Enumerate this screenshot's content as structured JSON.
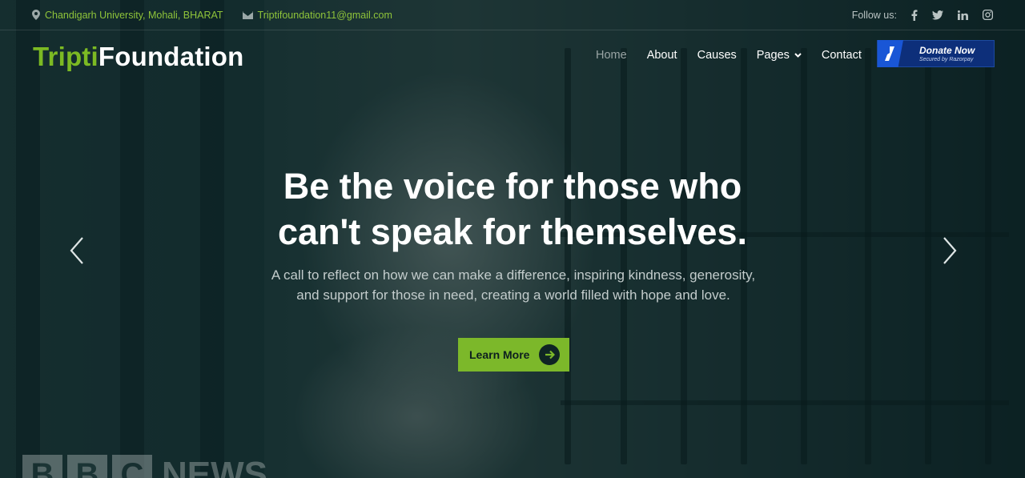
{
  "topbar": {
    "address": "Chandigarh University, Mohali, BHARAT",
    "email": "Triptifoundation11@gmail.com",
    "follow_label": "Follow us:",
    "socials": [
      "facebook-icon",
      "twitter-icon",
      "linkedin-icon",
      "instagram-icon"
    ]
  },
  "brand": {
    "part1": "Tripti",
    "part2": "Foundation",
    "accent": "#7cba23"
  },
  "nav": {
    "items": [
      "Home",
      "About",
      "Causes",
      "Pages",
      "Contact"
    ],
    "active": "Home"
  },
  "donate": {
    "title": "Donate Now",
    "subtitle": "Secured by Razorpay"
  },
  "hero": {
    "line1": "Be the voice for those who",
    "line2": "can't speak for themselves.",
    "sub_line1": "A call to reflect on how we can make a difference, inspiring kindness, generosity,",
    "sub_line2": "and support for those in need, creating a world filled with hope and love.",
    "cta": "Learn More",
    "cta_color": "#7cb82a"
  },
  "watermark": {
    "letters": [
      "B",
      "B",
      "C"
    ],
    "word": "NEWS"
  }
}
